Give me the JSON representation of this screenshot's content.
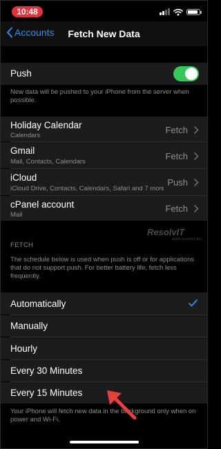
{
  "status_bar": {
    "time": "10:48"
  },
  "nav": {
    "back_label": "Accounts",
    "title": "Fetch New Data"
  },
  "push": {
    "label": "Push",
    "enabled": true,
    "footnote": "New data will be pushed to your iPhone from the server when possible."
  },
  "accounts": [
    {
      "name": "Holiday Calendar",
      "services": "Calendars",
      "mode": "Fetch"
    },
    {
      "name": "Gmail",
      "services": "Mail, Contacts, Calendars",
      "mode": "Fetch"
    },
    {
      "name": "iCloud",
      "services": "iCloud Drive, Contacts, Calendars, Safari and 7 more...",
      "mode": "Push"
    },
    {
      "name": "cPanel account",
      "services": "Mail",
      "mode": "Fetch"
    }
  ],
  "watermark": {
    "text": "ResolvIT",
    "subtext": "www.resolvit.biz"
  },
  "fetch": {
    "header": "FETCH",
    "description": "The schedule below is used when push is off or for applications that do not support push. For better battery life, fetch less frequently.",
    "options": [
      {
        "label": "Automatically",
        "selected": true
      },
      {
        "label": "Manually",
        "selected": false
      },
      {
        "label": "Hourly",
        "selected": false
      },
      {
        "label": "Every 30 Minutes",
        "selected": false
      },
      {
        "label": "Every 15 Minutes",
        "selected": false
      }
    ],
    "footnote": "Your iPhone will fetch new data in the background only when on power and Wi-Fi."
  },
  "colors": {
    "accent": "#2e8ef5",
    "toggle_on": "#34c759",
    "annotation_arrow": "#e8403a",
    "cell_background": "#1c1c1e"
  },
  "icons": {
    "back": "chevron-left-icon",
    "disclosure": "chevron-right-icon",
    "selected": "checkmark-icon",
    "wifi": "wifi-icon",
    "signal": "signal-icon",
    "battery": "battery-icon",
    "annotation": "arrow-icon"
  },
  "battery_level": 0.85
}
